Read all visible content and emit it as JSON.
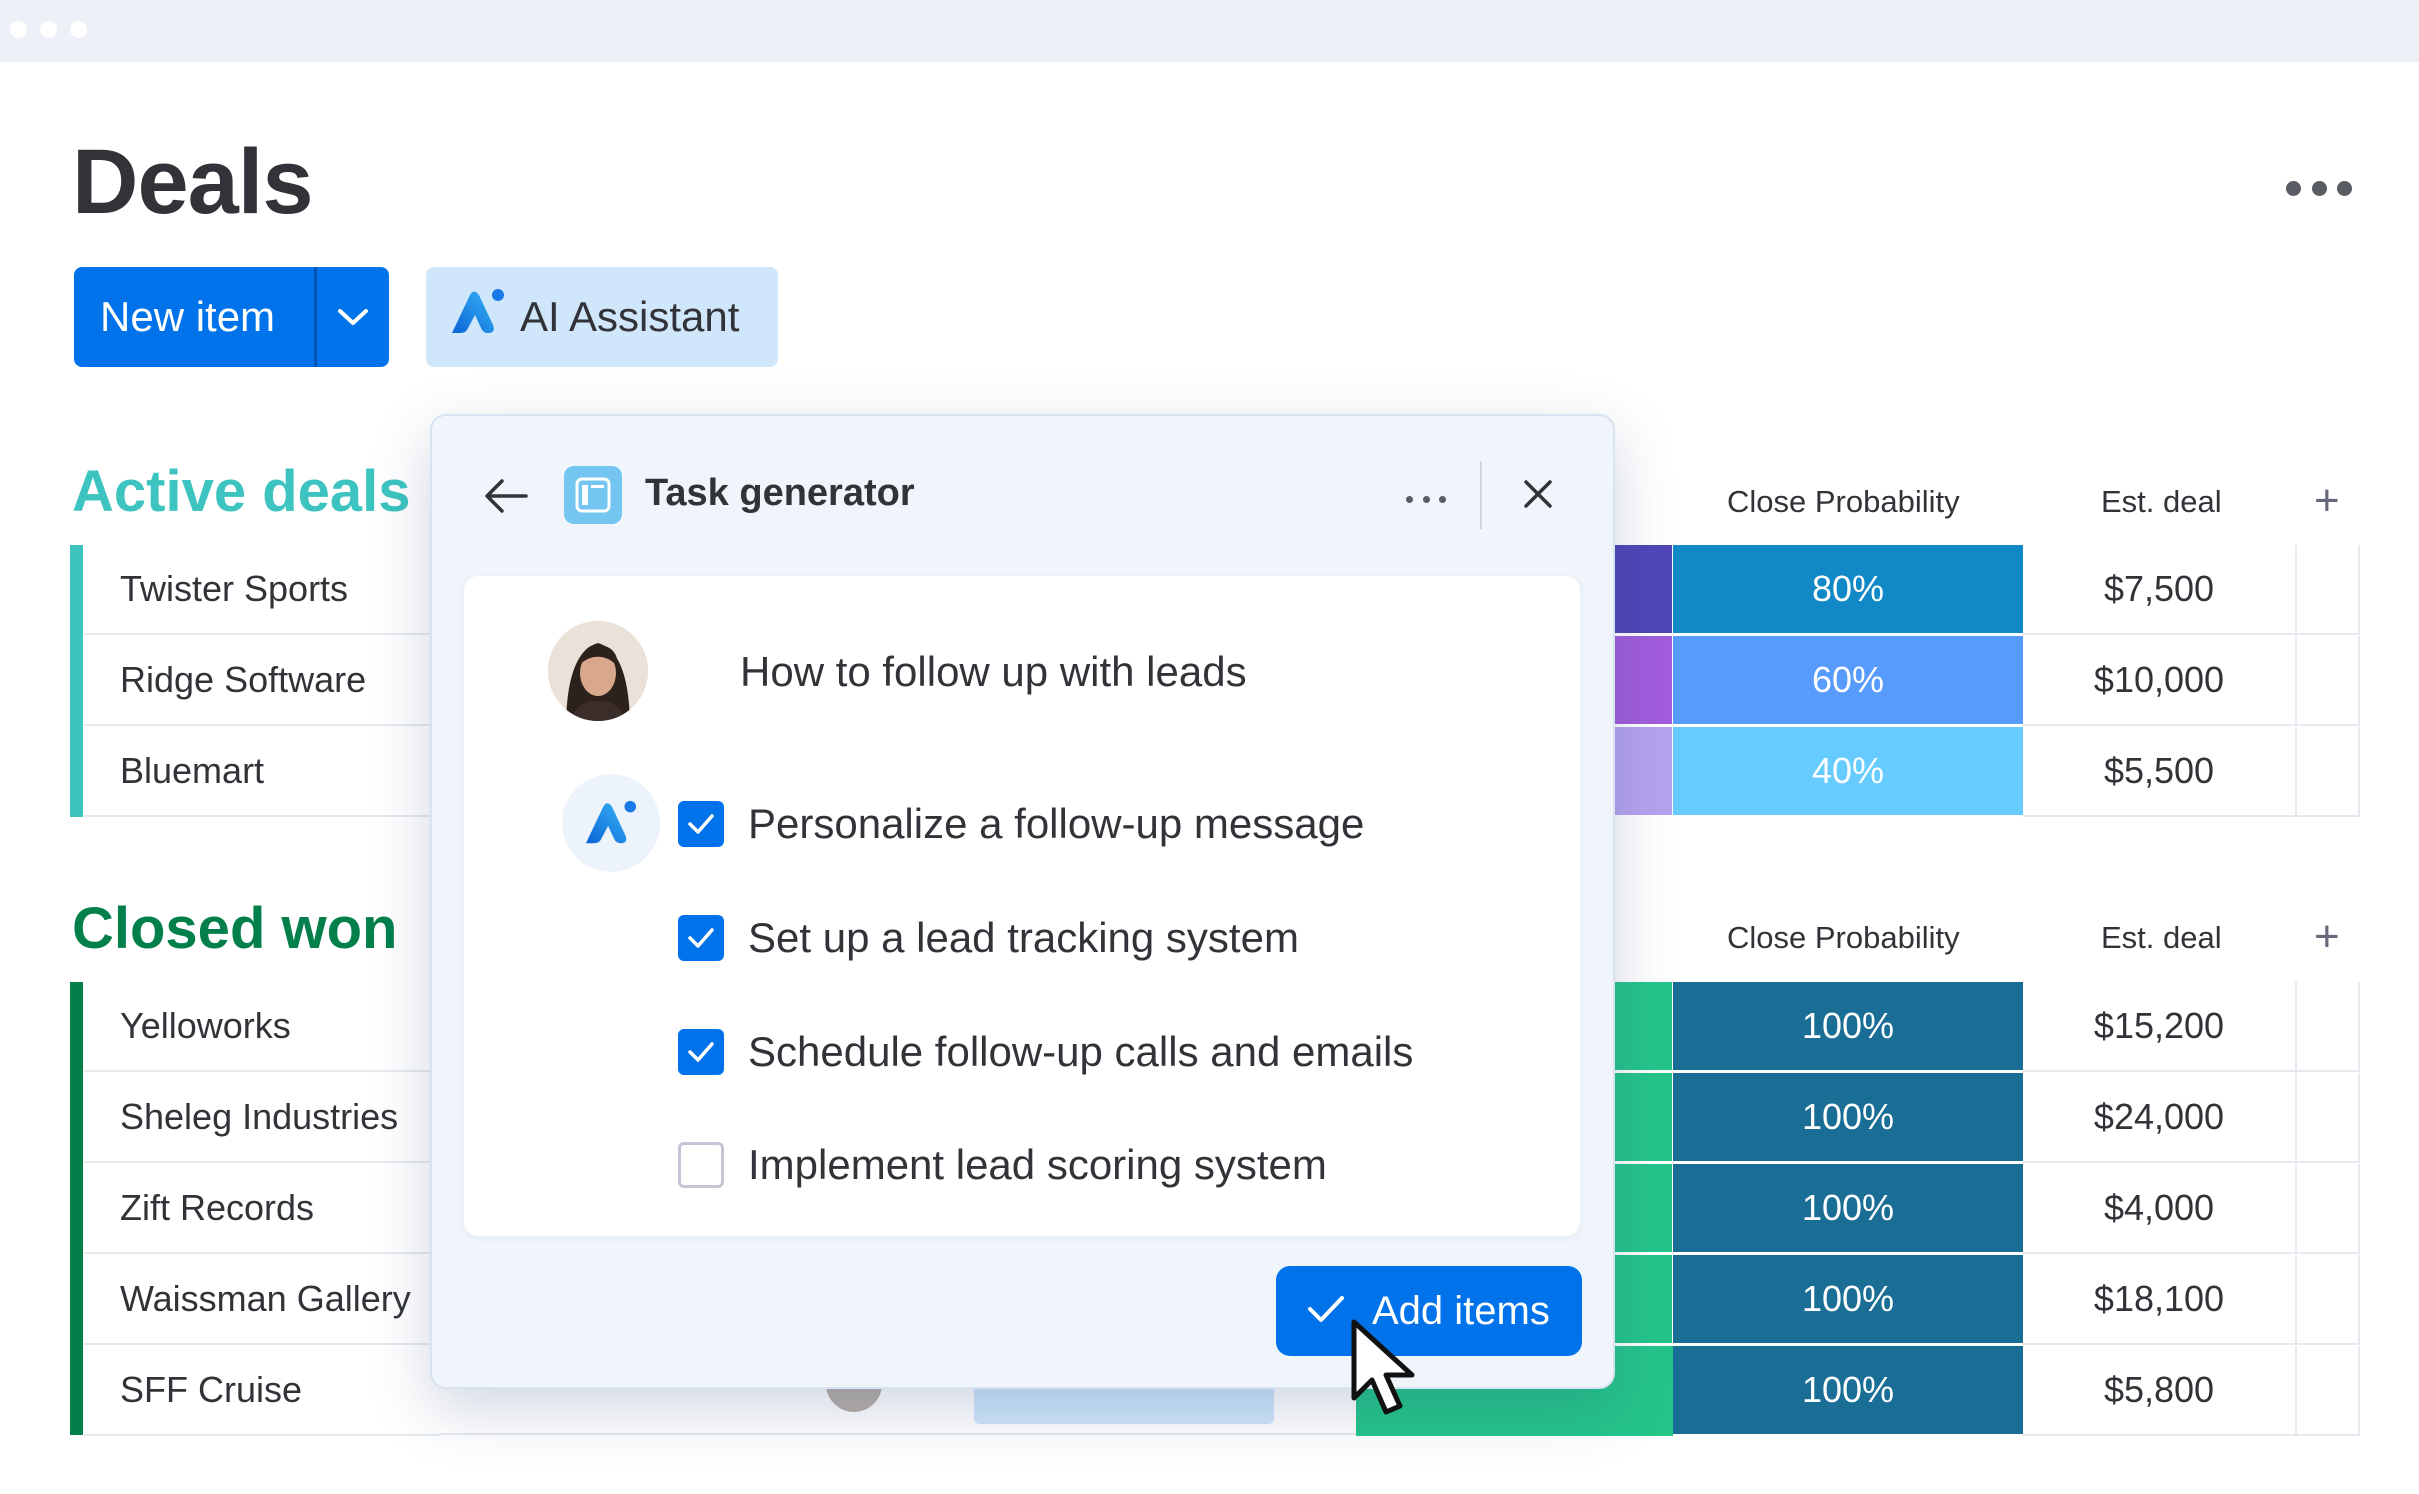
{
  "page": {
    "title": "Deals",
    "new_item_label": "New item",
    "ai_assistant_label": "AI Assistant"
  },
  "colors": {
    "accent_blue": "#0073ea",
    "active_group": "#3dc4c0",
    "won_group": "#037f4c",
    "won_status": "#25c58a",
    "prob_100": "#1a6e96",
    "prob_80": "#1189c7",
    "prob_60": "#579bfc",
    "prob_40": "#66ccff"
  },
  "groups": {
    "active": {
      "title": "Active deals",
      "col_probability": "Close Probability",
      "col_deal": "Est. deal",
      "rows": [
        {
          "name": "Twister Sports",
          "probability": "80%",
          "deal": "$7,500"
        },
        {
          "name": "Ridge Software",
          "probability": "60%",
          "deal": "$10,000"
        },
        {
          "name": "Bluemart",
          "probability": "40%",
          "deal": "$5,500"
        }
      ]
    },
    "won": {
      "title": "Closed won",
      "col_probability": "Close Probability",
      "col_deal": "Est. deal",
      "rows": [
        {
          "name": "Yelloworks",
          "probability": "100%",
          "deal": "$15,200"
        },
        {
          "name": "Sheleg Industries",
          "probability": "100%",
          "deal": "$24,000"
        },
        {
          "name": "Zift Records",
          "probability": "100%",
          "deal": "$4,000"
        },
        {
          "name": "Waissman Gallery",
          "probability": "100%",
          "deal": "$18,100"
        },
        {
          "name": "SFF Cruise",
          "probability": "100%",
          "deal": "$5,800"
        }
      ]
    }
  },
  "panel": {
    "title": "Task generator",
    "prompt": "How to follow up with leads",
    "tasks": [
      {
        "label": "Personalize a follow-up message",
        "checked": true
      },
      {
        "label": "Set up a lead tracking system",
        "checked": true
      },
      {
        "label": "Schedule follow-up calls and emails",
        "checked": true
      },
      {
        "label": "Implement lead scoring system",
        "checked": false
      }
    ],
    "add_label": "Add items"
  },
  "icons": [
    "arrow-left-icon",
    "task-generator-icon",
    "more-icon",
    "close-icon",
    "check-icon",
    "ai-logo-icon",
    "chevron-down-icon",
    "plus-icon",
    "cursor-icon"
  ]
}
